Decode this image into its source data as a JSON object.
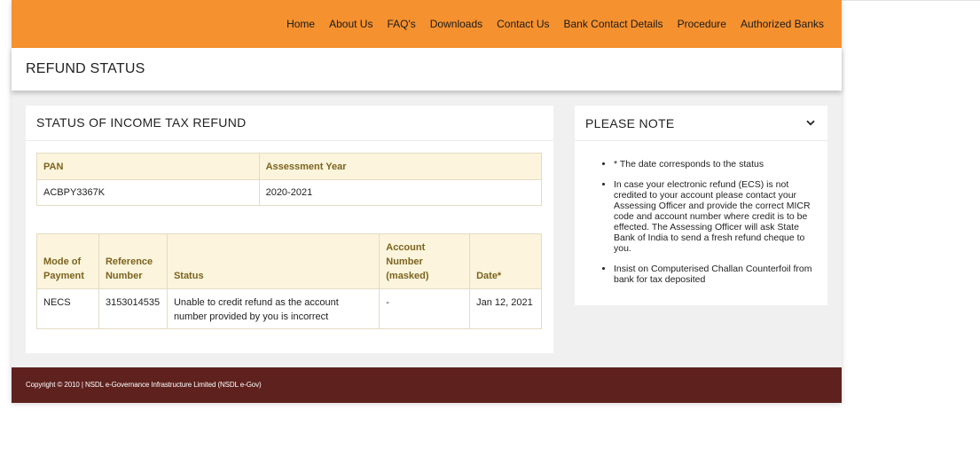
{
  "nav": {
    "items": [
      "Home",
      "About Us",
      "FAQ's",
      "Downloads",
      "Contact Us",
      "Bank Contact Details",
      "Procedure",
      "Authorized Banks"
    ]
  },
  "page_title": "REFUND STATUS",
  "status_panel": {
    "title": "STATUS OF INCOME TAX REFUND",
    "pan_table": {
      "headers": [
        "PAN",
        "Assessment Year"
      ],
      "row": [
        "ACBPY3367K",
        "2020-2021"
      ]
    },
    "refund_table": {
      "headers": [
        "Mode of Payment",
        "Reference Number",
        "Status",
        "Account Number (masked)",
        "Date*"
      ],
      "row": [
        "NECS",
        "3153014535",
        "Unable to credit refund as the account number provided by you is incorrect",
        "-",
        "Jan 12, 2021"
      ]
    }
  },
  "note_panel": {
    "title": "PLEASE NOTE",
    "toggle_icon": "chevron-down-icon",
    "items": [
      "* The date corresponds to the status",
      "In case your electronic refund (ECS) is not credited to your account please contact your Assessing Officer and provide the correct MICR code and account number where credit is to be effected. The Assessing Officer will ask State Bank of India to send a fresh refund cheque to you.",
      "Insist on Computerised Challan Counterfoil from bank for tax deposited"
    ]
  },
  "footer": {
    "copyright": "Copyright © 2010 | NSDL e-Governance Infrastructure Limited (NSDL e-Gov)"
  },
  "colors": {
    "navbar": "#f6912f",
    "footer": "#5e211e",
    "table_header_bg": "#fcf4dc",
    "table_header_text": "#7b6420"
  }
}
